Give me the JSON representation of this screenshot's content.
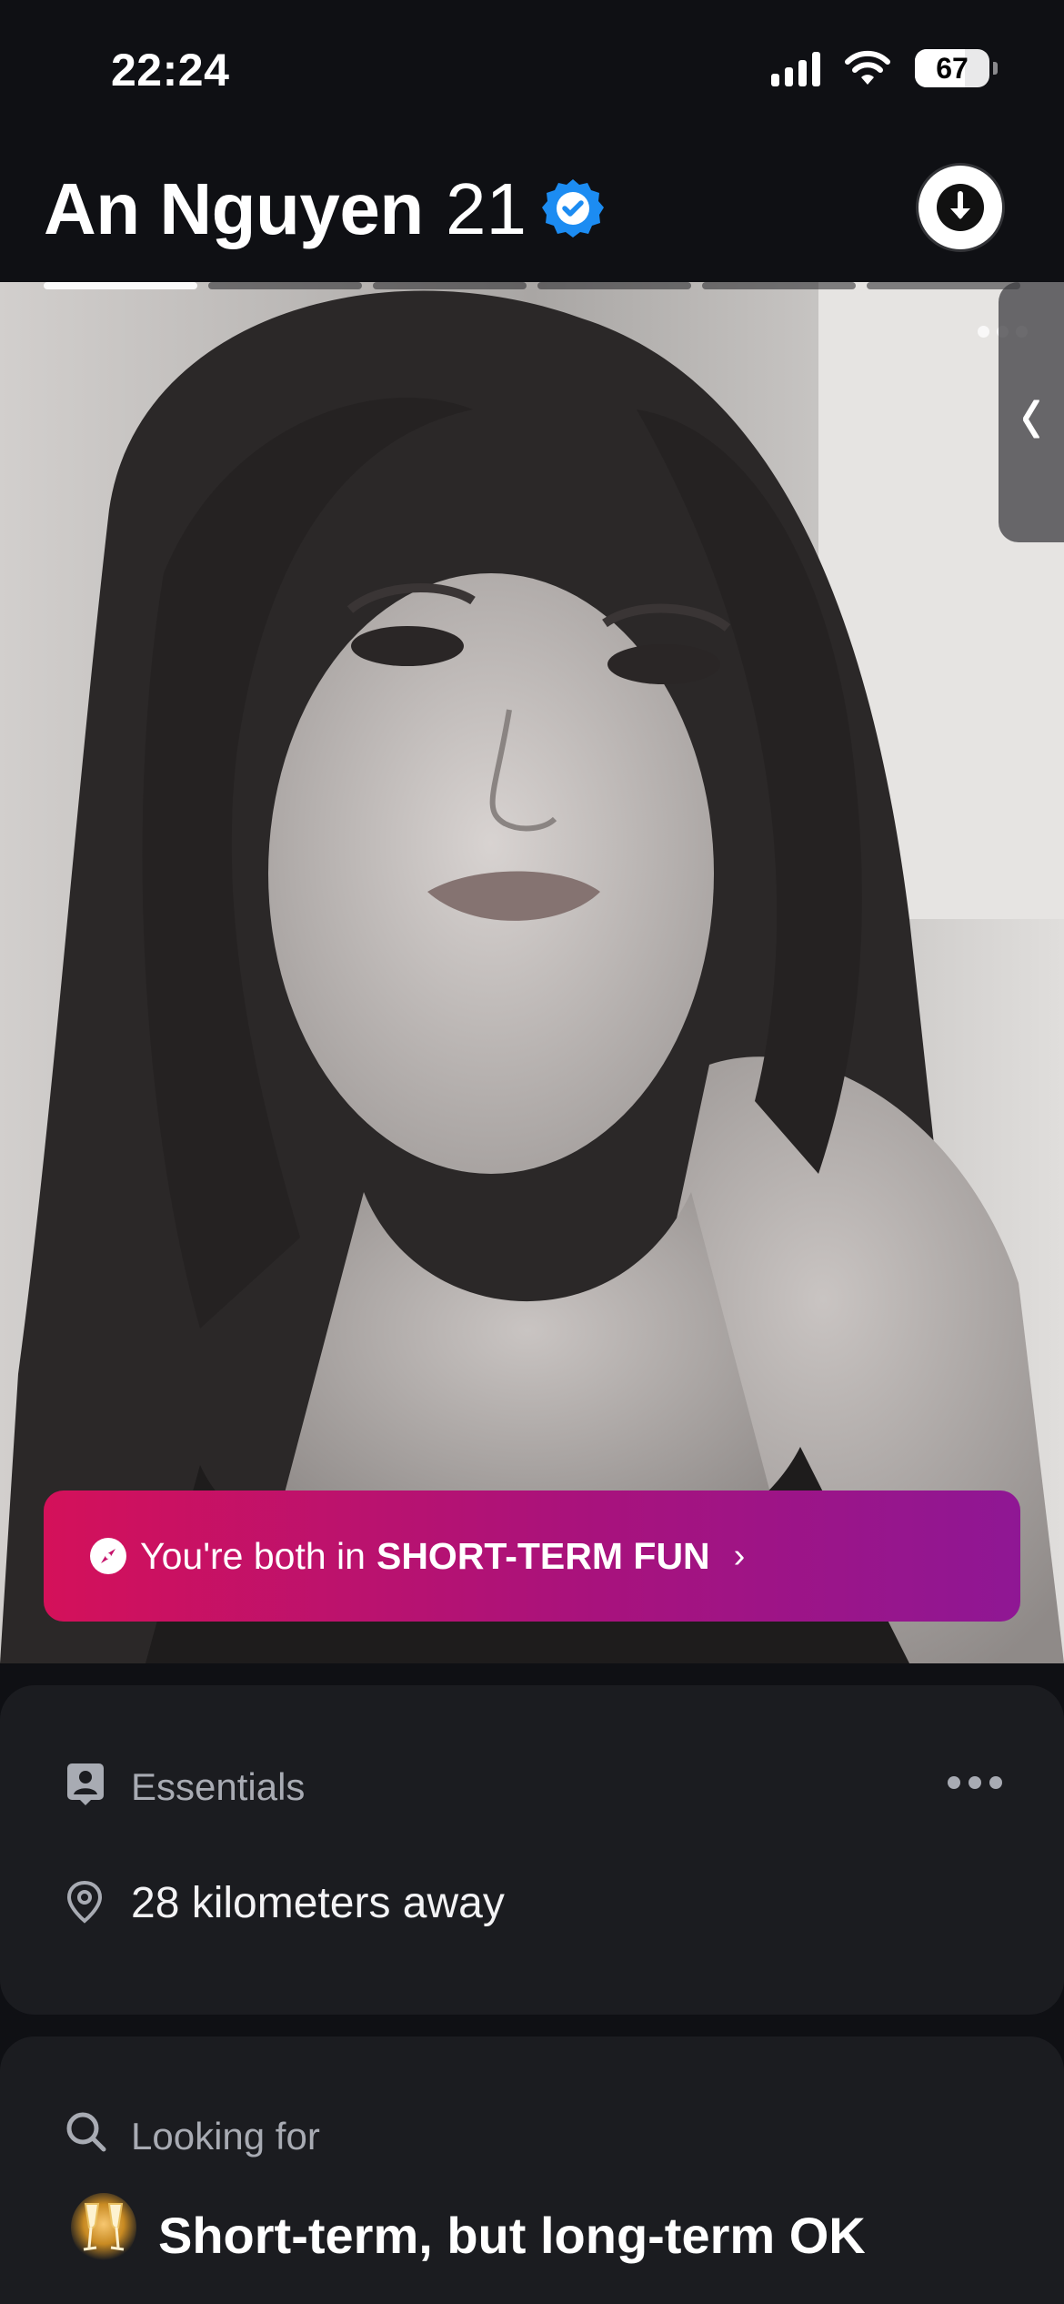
{
  "status_bar": {
    "time": "22:24",
    "battery": "67"
  },
  "profile": {
    "name": "An Nguyen",
    "age": "21",
    "photo_count": 6,
    "active_photo_index": 0
  },
  "match_banner": {
    "prefix": "You're both in",
    "highlight": "SHORT-TERM FUN",
    "chevron": "›"
  },
  "essentials": {
    "title": "Essentials",
    "distance": "28 kilometers away"
  },
  "looking_for": {
    "title": "Looking for",
    "emoji": "🥂",
    "value": "Short-term, but long-term OK"
  },
  "colors": {
    "banner_start": "#d4115a",
    "banner_end": "#8f1794",
    "verified_blue": "#1c8cf2",
    "card_bg": "#1b1c20"
  },
  "icons": {
    "verified": "verified-badge-icon",
    "collapse": "arrow-down-icon",
    "compass": "compass-icon",
    "essentials": "id-card-icon",
    "location": "location-pin-icon",
    "search": "search-icon"
  }
}
